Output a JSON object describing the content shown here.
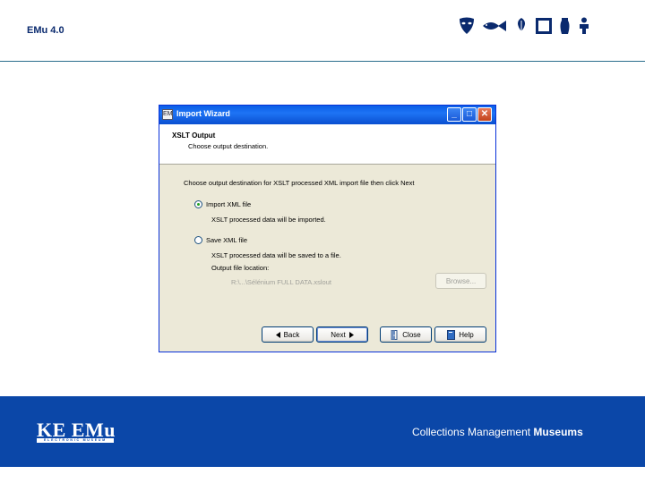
{
  "slide": {
    "title": "EMu 4.0",
    "icons": [
      "mask-icon",
      "fish-icon",
      "leaf-icon",
      "frame-icon",
      "vase-icon",
      "figure-icon"
    ]
  },
  "dialog": {
    "title": "Import Wizard",
    "app_icon_text": "EM",
    "controls": {
      "minimize": "_",
      "maximize": "□",
      "close": "✕"
    },
    "header_title": "XSLT Output",
    "header_subtitle": "Choose output destination.",
    "instruction": "Choose output destination for XSLT processed XML import file then click Next",
    "option_import": {
      "label": "Import XML file",
      "selected": true,
      "description": "XSLT processed data will be imported."
    },
    "option_save": {
      "label": "Save XML file",
      "selected": false,
      "description": "XSLT processed data will be saved to a file.",
      "location_label": "Output file location:",
      "location_value": "R:\\...\\Sélénium FULL DATA.xslout",
      "browse_label": "Browse..."
    },
    "buttons": {
      "back": "Back",
      "next": "Next",
      "close": "Close",
      "help": "Help"
    }
  },
  "footer": {
    "logo": "KE EMu",
    "logo_subtitle": "ELECTRONIC MUSEUM",
    "tagline_regular": "Collections Management",
    "tagline_bold": "Museums",
    "band_color": "#0b47a8"
  }
}
